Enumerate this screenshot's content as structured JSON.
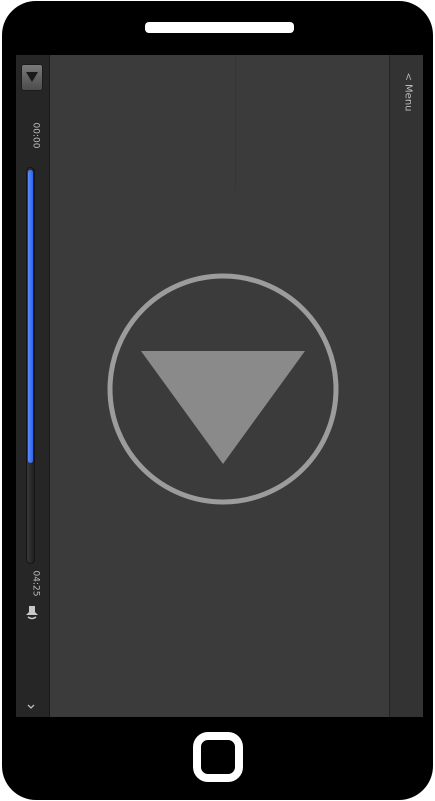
{
  "player": {
    "time_start": "00:00",
    "time_end": "04:25",
    "progress_percent": 75
  },
  "menu": {
    "label": "< Menu"
  },
  "colors": {
    "accent": "#3f74f5",
    "screen_bg": "#3b3b3b",
    "panel_bg": "#262626",
    "play_icon": "#8a8a8a"
  },
  "icons": {
    "dropdown": "triangle-down-icon",
    "volume": "speaker-icon",
    "chevron": "chevron-down-icon",
    "play": "play-circle-icon"
  }
}
